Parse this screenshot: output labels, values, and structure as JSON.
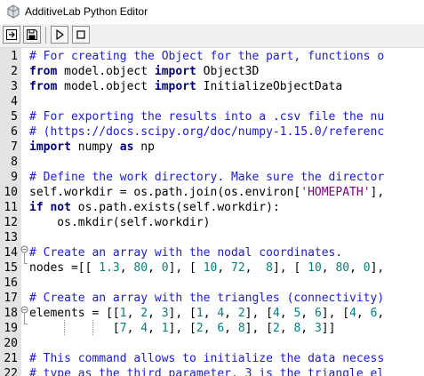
{
  "window": {
    "title": "AdditiveLab Python Editor",
    "app_icon": "additivelab-logo-icon"
  },
  "toolbar": {
    "buttons": [
      {
        "name": "import-button",
        "icon": "import-arrow-icon"
      },
      {
        "name": "save-button",
        "icon": "floppy-disk-icon"
      },
      {
        "name": "run-button",
        "icon": "play-icon"
      },
      {
        "name": "stop-button",
        "icon": "stop-square-icon"
      }
    ]
  },
  "colors": {
    "comment": "#1b1bd6",
    "keyword": "#00007f",
    "string": "#7f007f",
    "number": "#007f7f",
    "gutter": "#e4e4e4"
  },
  "editor": {
    "lines": [
      {
        "n": "1",
        "tokens": [
          [
            "c",
            "# For creating the Object for the part, functions o"
          ]
        ]
      },
      {
        "n": "2",
        "tokens": [
          [
            "k",
            "from"
          ],
          [
            "p",
            " model.object "
          ],
          [
            "k",
            "import"
          ],
          [
            "p",
            " Object3D"
          ]
        ]
      },
      {
        "n": "3",
        "tokens": [
          [
            "k",
            "from"
          ],
          [
            "p",
            " model.object "
          ],
          [
            "k",
            "import"
          ],
          [
            "p",
            " InitializeObjectData"
          ]
        ]
      },
      {
        "n": "4",
        "tokens": []
      },
      {
        "n": "5",
        "tokens": [
          [
            "c",
            "# For exporting the results into a .csv file the nu"
          ]
        ]
      },
      {
        "n": "6",
        "tokens": [
          [
            "c",
            "# (https://docs.scipy.org/doc/numpy-1.15.0/referenc"
          ]
        ]
      },
      {
        "n": "7",
        "tokens": [
          [
            "k",
            "import"
          ],
          [
            "p",
            " numpy "
          ],
          [
            "k",
            "as"
          ],
          [
            "p",
            " np"
          ]
        ]
      },
      {
        "n": "8",
        "tokens": []
      },
      {
        "n": "9",
        "tokens": [
          [
            "c",
            "# Define the work directory. Make sure the director"
          ]
        ]
      },
      {
        "n": "10",
        "tokens": [
          [
            "p",
            "self.workdir = os.path.join(os.environ["
          ],
          [
            "s",
            "'HOMEPATH'"
          ],
          [
            "p",
            "],"
          ]
        ]
      },
      {
        "n": "11",
        "tokens": [
          [
            "k",
            "if"
          ],
          [
            "p",
            " "
          ],
          [
            "k",
            "not"
          ],
          [
            "p",
            " os.path.exists(self.workdir):"
          ]
        ]
      },
      {
        "n": "12",
        "tokens": [
          [
            "p",
            "    os.mkdir(self.workdir)"
          ]
        ]
      },
      {
        "n": "13",
        "tokens": []
      },
      {
        "n": "14",
        "tokens": [
          [
            "c",
            "# Create an array with the nodal coordinates."
          ]
        ]
      },
      {
        "n": "15",
        "tokens": [
          [
            "p",
            "nodes =[[ "
          ],
          [
            "n",
            "1.3"
          ],
          [
            "p",
            ", "
          ],
          [
            "n",
            "80"
          ],
          [
            "p",
            ", "
          ],
          [
            "n",
            "0"
          ],
          [
            "p",
            "], [ "
          ],
          [
            "n",
            "10"
          ],
          [
            "p",
            ", "
          ],
          [
            "n",
            "72"
          ],
          [
            "p",
            ",  "
          ],
          [
            "n",
            "8"
          ],
          [
            "p",
            "], [ "
          ],
          [
            "n",
            "10"
          ],
          [
            "p",
            ", "
          ],
          [
            "n",
            "80"
          ],
          [
            "p",
            ", "
          ],
          [
            "n",
            "0"
          ],
          [
            "p",
            "],"
          ]
        ]
      },
      {
        "n": "16",
        "tokens": []
      },
      {
        "n": "17",
        "tokens": [
          [
            "c",
            "# Create an array with the triangles (connectivity)"
          ]
        ]
      },
      {
        "n": "18",
        "tokens": [
          [
            "p",
            "elements = [["
          ],
          [
            "n",
            "1"
          ],
          [
            "p",
            ", "
          ],
          [
            "n",
            "2"
          ],
          [
            "p",
            ", "
          ],
          [
            "n",
            "3"
          ],
          [
            "p",
            "], ["
          ],
          [
            "n",
            "1"
          ],
          [
            "p",
            ", "
          ],
          [
            "n",
            "4"
          ],
          [
            "p",
            ", "
          ],
          [
            "n",
            "2"
          ],
          [
            "p",
            "], ["
          ],
          [
            "n",
            "4"
          ],
          [
            "p",
            ", "
          ],
          [
            "n",
            "5"
          ],
          [
            "p",
            ", "
          ],
          [
            "n",
            "6"
          ],
          [
            "p",
            "], ["
          ],
          [
            "n",
            "4"
          ],
          [
            "p",
            ", "
          ],
          [
            "n",
            "6"
          ],
          [
            "p",
            ","
          ]
        ]
      },
      {
        "n": "19",
        "tokens": [
          [
            "p",
            "            ["
          ],
          [
            "n",
            "7"
          ],
          [
            "p",
            ", "
          ],
          [
            "n",
            "4"
          ],
          [
            "p",
            ", "
          ],
          [
            "n",
            "1"
          ],
          [
            "p",
            "], ["
          ],
          [
            "n",
            "2"
          ],
          [
            "p",
            ", "
          ],
          [
            "n",
            "6"
          ],
          [
            "p",
            ", "
          ],
          [
            "n",
            "8"
          ],
          [
            "p",
            "], ["
          ],
          [
            "n",
            "2"
          ],
          [
            "p",
            ", "
          ],
          [
            "n",
            "8"
          ],
          [
            "p",
            ", "
          ],
          [
            "n",
            "3"
          ],
          [
            "p",
            "]]"
          ]
        ]
      },
      {
        "n": "20",
        "tokens": []
      },
      {
        "n": "21",
        "tokens": [
          [
            "c",
            "# This command allows to initialize the data necess"
          ]
        ]
      },
      {
        "n": "22",
        "tokens": [
          [
            "c",
            "# type as the third parameter, 3 is the triangle el"
          ]
        ]
      }
    ]
  }
}
